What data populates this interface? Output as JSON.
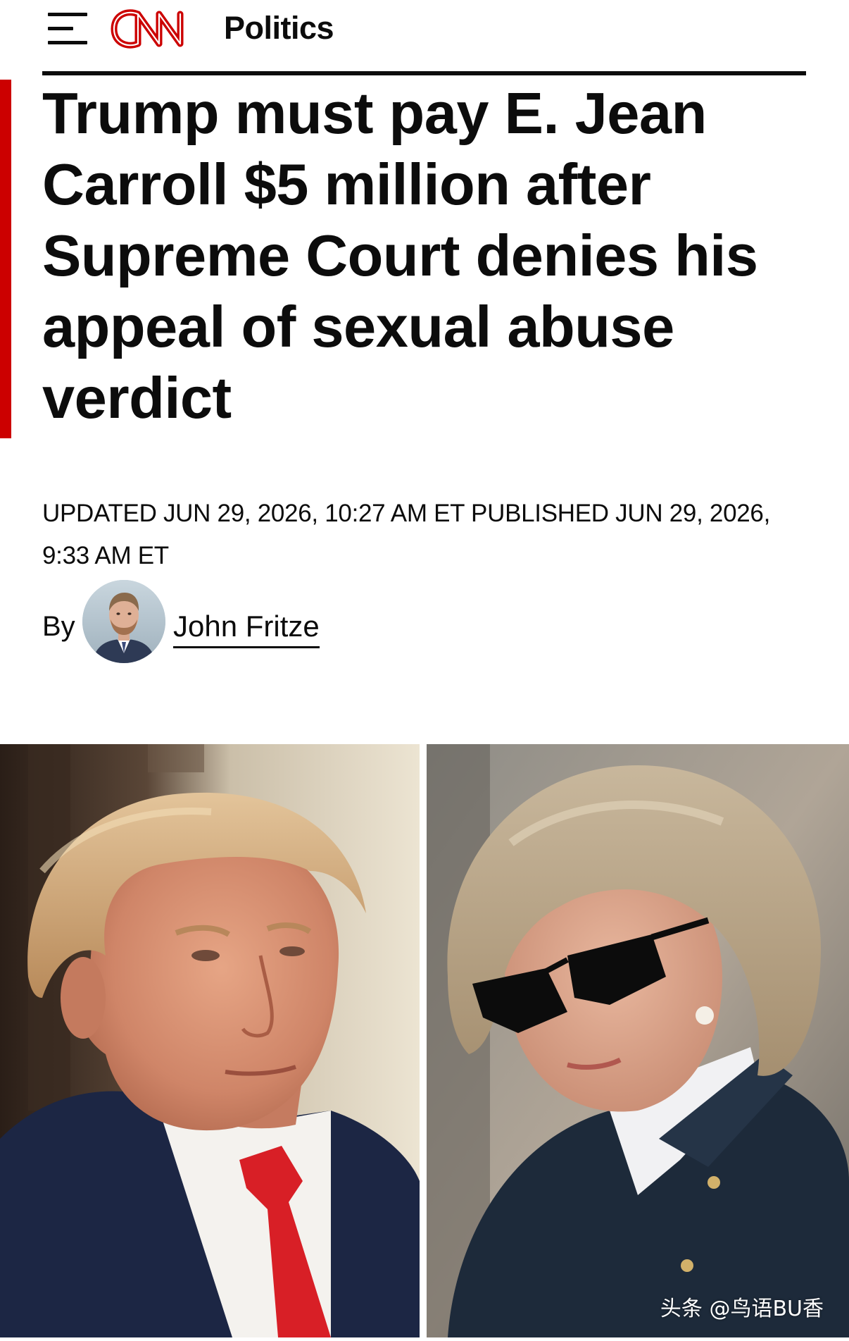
{
  "header": {
    "logo_text": "CNN",
    "section": "Politics",
    "menu_icon": "hamburger-menu-icon"
  },
  "article": {
    "headline": "Trump must pay E. Jean Carroll $5 million after Supreme Court denies his appeal of sexual abuse verdict",
    "timestamp": "UPDATED JUN 29, 2026, 10:27 AM ET PUBLISHED JUN 29, 2026, 9:33 AM ET",
    "byline_prefix": "By",
    "author": "John Fritze"
  },
  "hero_image": {
    "watermark": "头条 @鸟语BU香"
  },
  "colors": {
    "brand_red": "#cc0000",
    "text": "#0c0c0c",
    "background": "#ffffff"
  }
}
